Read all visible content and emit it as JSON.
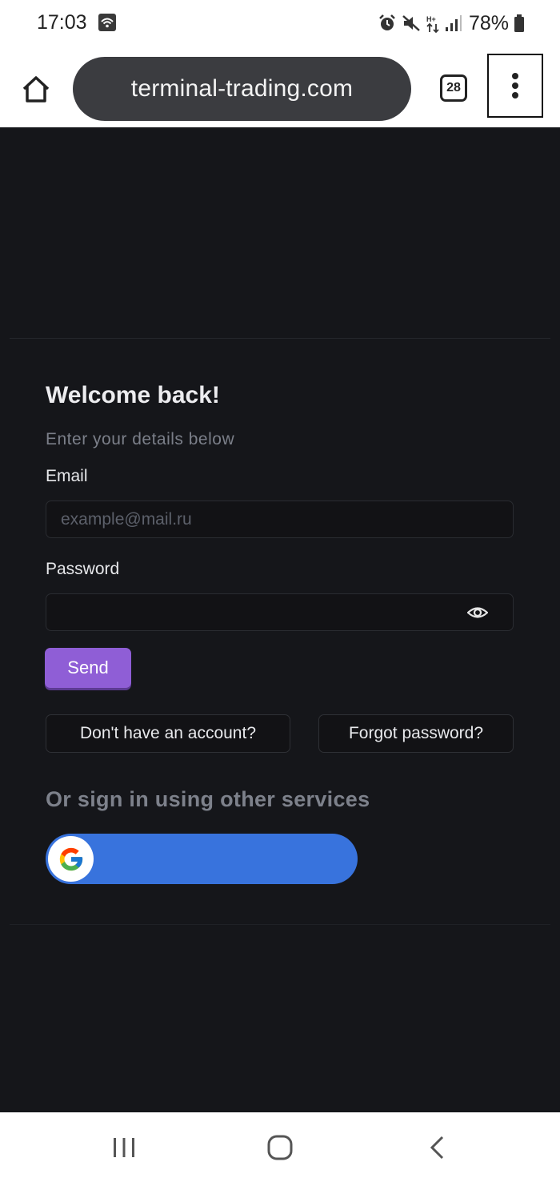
{
  "status_bar": {
    "time": "17:03",
    "battery_percent": "78%",
    "icons": [
      "wifi-icon",
      "alarm-icon",
      "mute-icon",
      "data-arrows-icon",
      "signal-icon",
      "battery-icon"
    ]
  },
  "browser": {
    "url": "terminal-trading.com",
    "tab_count": "28",
    "icons": [
      "home-icon",
      "tabs-icon",
      "more-vertical-icon"
    ]
  },
  "login": {
    "title": "Welcome back!",
    "subtitle": "Enter your details below",
    "email_label": "Email",
    "email_placeholder": "example@mail.ru",
    "email_value": "",
    "password_label": "Password",
    "password_value": "",
    "send_label": "Send",
    "signup_label": "Don't have an account?",
    "forgot_label": "Forgot password?",
    "other_services_label": "Or sign in using other services",
    "google_label": ""
  },
  "nav": {
    "icons": [
      "recents-icon",
      "home-nav-icon",
      "back-icon"
    ]
  },
  "colors": {
    "page_background": "#15161a",
    "accent_purple": "#8f5ed6",
    "google_blue": "#3873dd",
    "pointer_hand": "#c7a4f2"
  }
}
